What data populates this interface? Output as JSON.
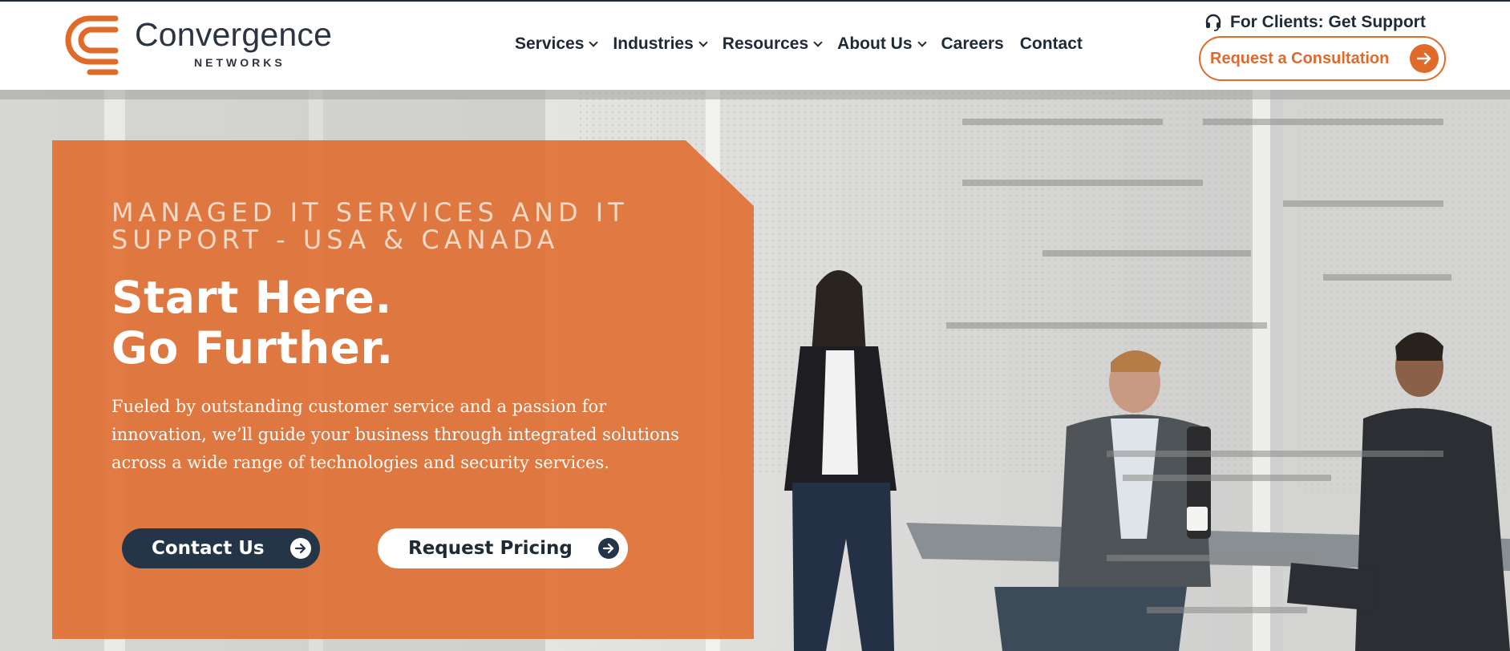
{
  "brand": {
    "name": "Convergence",
    "subname": "NETWORKS",
    "accent_color": "#e06a2a",
    "dark_color": "#233547"
  },
  "nav": {
    "items": [
      {
        "label": "Services",
        "has_dropdown": true
      },
      {
        "label": "Industries",
        "has_dropdown": true
      },
      {
        "label": "Resources",
        "has_dropdown": true
      },
      {
        "label": "About Us",
        "has_dropdown": true
      },
      {
        "label": "Careers",
        "has_dropdown": false
      },
      {
        "label": "Contact",
        "has_dropdown": false
      }
    ]
  },
  "header": {
    "support_label": "For Clients: Get Support",
    "support_icon": "headset-icon",
    "consult_label": "Request a Consultation",
    "consult_icon": "arrow-right-icon"
  },
  "hero": {
    "eyebrow_line1": "MANAGED IT SERVICES AND IT",
    "eyebrow_line2": "SUPPORT - USA & CANADA",
    "headline_line1": "Start Here.",
    "headline_line2": "Go Further.",
    "body": "Fueled by outstanding customer service and a passion for innovation, we’ll guide your business through integrated solutions across a wide range of technologies and security services.",
    "contact_label": "Contact Us",
    "pricing_label": "Request Pricing"
  }
}
